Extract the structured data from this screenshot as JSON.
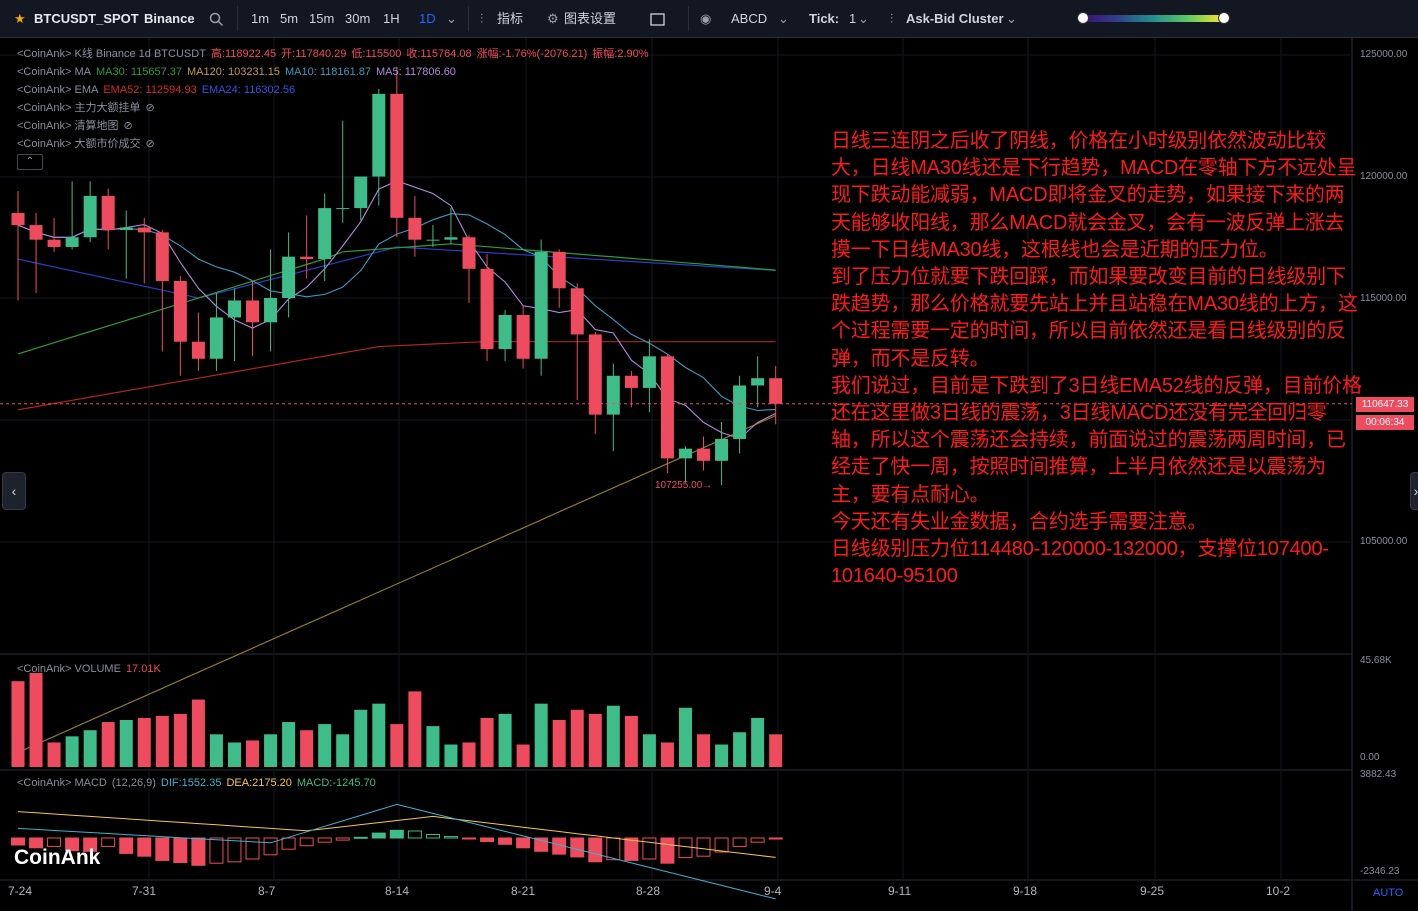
{
  "toolbar": {
    "symbol": "BTCUSDT_SPOT",
    "exchange": "Binance",
    "timeframes": [
      "1m",
      "5m",
      "15m",
      "30m",
      "1H",
      "1D"
    ],
    "active_timeframe": "1D",
    "indicators_label": "指标",
    "chart_settings_label": "图表设置",
    "drawing_label": "ABCD",
    "tick_label": "Tick:",
    "tick_value": "1",
    "cluster_label": "Ask-Bid Cluster"
  },
  "legend": {
    "line1": {
      "prefix": "<CoinAnk> K线  Binance 1d BTCUSDT",
      "high": "高:118922.45",
      "open": "开:117840.29",
      "low": "低:115500",
      "close": "收:115764.08",
      "change": "涨幅:-1.76%(-2076.21)",
      "amp": "振幅:2.90%"
    },
    "line2": {
      "prefix": "<CoinAnk> MA",
      "ma30": "MA30: 115657.37",
      "ma120": "MA120: 103231.15",
      "ma10": "MA10: 118161.87",
      "ma5": "MA5: 117806.60"
    },
    "line3": {
      "prefix": "<CoinAnk> EMA",
      "ema52": "EMA52: 112594.93",
      "ema24": "EMA24: 116302.56"
    },
    "line4": "<CoinAnk> 主力大额挂单",
    "line5": "<CoinAnk> 清算地图",
    "line6": "<CoinAnk> 大额市价成交"
  },
  "volume_legend": {
    "prefix": "<CoinAnk> VOLUME",
    "value": "17.01K"
  },
  "macd_legend": {
    "prefix": "<CoinAnk> MACD",
    "params": "(12,26,9)",
    "dif": "DIF:1552.35",
    "dea": "DEA:2175.20",
    "macd": "MACD:-1245.70"
  },
  "annotation": [
    "日线三连阴之后收了阴线，价格在小时级别依然波动比较大，日线MA30线还是下行趋势，MACD在零轴下方不远处呈现下跌动能减弱，MACD即将金叉的走势，如果接下来的两天能够收阳线，那么MACD就会金叉，会有一波反弹上涨去摸一下日线MA30线，这根线也会是近期的压力位。",
    "到了压力位就要下跌回踩，而如果要改变目前的日线级别下跌趋势，那么价格就要先站上并且站稳在MA30线的上方，这个过程需要一定的时间，所以目前依然还是看日线级别的反弹，而不是反转。",
    "我们说过，目前是下跌到了3日线EMA52线的反弹，目前价格还在这里做3日线的震荡，3日线MACD还没有完全回归零轴，所以这个震荡还会持续，前面说过的震荡两周时间，已经走了快一周，按照时间推算，上半月依然还是以震荡为主，要有点耐心。",
    "今天还有失业金数据，合约选手需要注意。",
    "日线级别压力位114480-120000-132000，支撑位107400-101640-95100"
  ],
  "price_axis": [
    "125000.00",
    "120000.00",
    "115000.00",
    "105000.00"
  ],
  "current_price": "110647.33",
  "countdown": "00:06:34",
  "low_marker": "107255.00",
  "volume_axis": [
    "45.68K",
    "0.00"
  ],
  "macd_axis": [
    "3882.43",
    "-2346.23"
  ],
  "x_axis": [
    "7-24",
    "7-31",
    "8-7",
    "8-14",
    "8-21",
    "8-28",
    "9-4",
    "9-11",
    "9-18",
    "9-25",
    "10-2"
  ],
  "watermark": "CoinAnk",
  "auto_label": "AUTO",
  "colors": {
    "up": "#3ebd8a",
    "down": "#ef4b5f",
    "ma30": "#2a9d3a",
    "ma5": "#b08ad8",
    "ma10": "#3a9dbd",
    "ema52": "#b02424",
    "ema24": "#2a3fc9",
    "ma120": "#8c7a2a",
    "annotation": "#ff1a1a"
  },
  "chart_data": {
    "type": "candlestick",
    "candles": [
      {
        "date": "7-24",
        "o": 118500,
        "h": 119400,
        "l": 114900,
        "c": 118000
      },
      {
        "date": "7-25",
        "o": 118000,
        "h": 118500,
        "l": 115200,
        "c": 117400
      },
      {
        "date": "7-26",
        "o": 117400,
        "h": 118300,
        "l": 116900,
        "c": 117100
      },
      {
        "date": "7-27",
        "o": 117100,
        "h": 119800,
        "l": 117000,
        "c": 117500
      },
      {
        "date": "7-28",
        "o": 117500,
        "h": 119800,
        "l": 117300,
        "c": 119200
      },
      {
        "date": "7-29",
        "o": 119200,
        "h": 119500,
        "l": 117000,
        "c": 117800
      },
      {
        "date": "7-30",
        "o": 117800,
        "h": 118600,
        "l": 115800,
        "c": 117900
      },
      {
        "date": "7-31",
        "o": 117900,
        "h": 118300,
        "l": 115600,
        "c": 117700
      },
      {
        "date": "8-1",
        "o": 117700,
        "h": 117800,
        "l": 112800,
        "c": 115700
      },
      {
        "date": "8-2",
        "o": 115700,
        "h": 115900,
        "l": 111800,
        "c": 113200
      },
      {
        "date": "8-3",
        "o": 113200,
        "h": 114400,
        "l": 112000,
        "c": 112500
      },
      {
        "date": "8-4",
        "o": 112500,
        "h": 115200,
        "l": 112000,
        "c": 114200
      },
      {
        "date": "8-5",
        "o": 114200,
        "h": 115400,
        "l": 112400,
        "c": 114900
      },
      {
        "date": "8-6",
        "o": 114900,
        "h": 115700,
        "l": 112600,
        "c": 114000
      },
      {
        "date": "8-7",
        "o": 114000,
        "h": 117000,
        "l": 112800,
        "c": 115000
      },
      {
        "date": "8-8",
        "o": 115000,
        "h": 117700,
        "l": 114200,
        "c": 116700
      },
      {
        "date": "8-9",
        "o": 116700,
        "h": 118400,
        "l": 115800,
        "c": 116600
      },
      {
        "date": "8-10",
        "o": 116600,
        "h": 119300,
        "l": 115700,
        "c": 118700
      },
      {
        "date": "8-11",
        "o": 118700,
        "h": 122300,
        "l": 118100,
        "c": 118700
      },
      {
        "date": "8-12",
        "o": 118700,
        "h": 120000,
        "l": 118200,
        "c": 120000
      },
      {
        "date": "8-13",
        "o": 120000,
        "h": 123600,
        "l": 118800,
        "c": 123400
      },
      {
        "date": "8-14",
        "o": 123400,
        "h": 124500,
        "l": 117500,
        "c": 118300
      },
      {
        "date": "8-15",
        "o": 118300,
        "h": 119200,
        "l": 116700,
        "c": 117400
      },
      {
        "date": "8-16",
        "o": 117400,
        "h": 118000,
        "l": 117100,
        "c": 117400
      },
      {
        "date": "8-17",
        "o": 117400,
        "h": 118700,
        "l": 117200,
        "c": 117500
      },
      {
        "date": "8-18",
        "o": 117500,
        "h": 117600,
        "l": 114800,
        "c": 116200
      },
      {
        "date": "8-19",
        "o": 116200,
        "h": 116800,
        "l": 112400,
        "c": 112900
      },
      {
        "date": "8-20",
        "o": 112900,
        "h": 114500,
        "l": 112400,
        "c": 114300
      },
      {
        "date": "8-21",
        "o": 114300,
        "h": 114700,
        "l": 112100,
        "c": 112500
      },
      {
        "date": "8-22",
        "o": 112500,
        "h": 117400,
        "l": 111800,
        "c": 116900
      },
      {
        "date": "8-23",
        "o": 116900,
        "h": 117000,
        "l": 114600,
        "c": 115400
      },
      {
        "date": "8-24",
        "o": 115400,
        "h": 115600,
        "l": 110800,
        "c": 113500
      },
      {
        "date": "8-25",
        "o": 113500,
        "h": 113600,
        "l": 109400,
        "c": 110200
      },
      {
        "date": "8-26",
        "o": 110200,
        "h": 112300,
        "l": 108700,
        "c": 111800
      },
      {
        "date": "8-27",
        "o": 111800,
        "h": 112000,
        "l": 110500,
        "c": 111300
      },
      {
        "date": "8-28",
        "o": 111300,
        "h": 113300,
        "l": 110300,
        "c": 112600
      },
      {
        "date": "8-29",
        "o": 112600,
        "h": 112700,
        "l": 107800,
        "c": 108400
      },
      {
        "date": "8-30",
        "o": 108400,
        "h": 108900,
        "l": 107400,
        "c": 108800
      },
      {
        "date": "8-31",
        "o": 108800,
        "h": 109300,
        "l": 107900,
        "c": 108300
      },
      {
        "date": "9-1",
        "o": 108300,
        "h": 109900,
        "l": 107300,
        "c": 109200
      },
      {
        "date": "9-2",
        "o": 109200,
        "h": 111800,
        "l": 108600,
        "c": 111400
      },
      {
        "date": "9-3",
        "o": 111400,
        "h": 112600,
        "l": 110500,
        "c": 111700
      },
      {
        "date": "9-4",
        "o": 111700,
        "h": 112200,
        "l": 109800,
        "c": 110647
      }
    ],
    "volume": [
      4.2,
      4.6,
      1.2,
      1.5,
      1.8,
      2.2,
      2.3,
      2.4,
      2.5,
      2.6,
      3.3,
      1.6,
      1.2,
      1.3,
      1.6,
      2.2,
      1.8,
      2.1,
      1.6,
      2.8,
      3.1,
      2.1,
      3.7,
      2.0,
      1.1,
      1.2,
      2.4,
      2.6,
      1.1,
      3.1,
      2.3,
      2.8,
      2.6,
      3.0,
      2.5,
      1.6,
      1.2,
      2.9,
      1.6,
      1.1,
      1.7,
      2.4,
      1.6
    ]
  }
}
